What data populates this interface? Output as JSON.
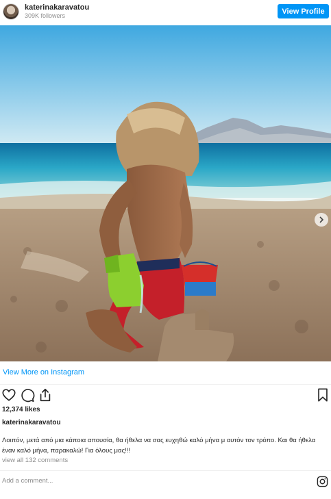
{
  "header": {
    "username": "katerinakaravatou",
    "followers": "309K followers",
    "view_profile_label": "View Profile"
  },
  "post": {
    "view_more_label": "View More on Instagram",
    "likes": "12,374 likes",
    "caption_username": "katerinakaravatou",
    "caption_text": "Λοιπόν, μετά από μια κάποια απουσία, θα ήθελα να σας ευχηθώ καλό μήνα μ αυτόν τον τρόπο. Και θα ήθελα έναν καλό μήνα, παρακαλώ! Για όλους μας!!!",
    "comments_link": "view all 132 comments",
    "add_comment_placeholder": "Add a comment..."
  },
  "carousel": {
    "total": 3,
    "active_index": 0
  },
  "icons": [
    "heart-icon",
    "comment-icon",
    "share-icon",
    "bookmark-icon",
    "instagram-icon",
    "chevron-right-icon"
  ],
  "colors": {
    "accent": "#0095f6",
    "text": "#262626",
    "muted": "#8e8e8e"
  }
}
